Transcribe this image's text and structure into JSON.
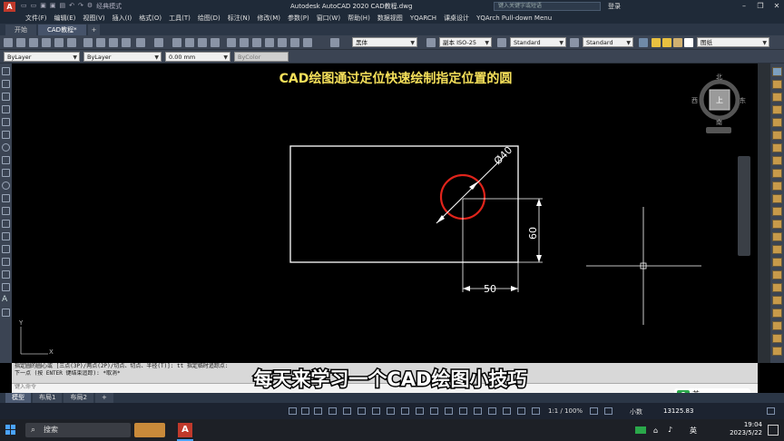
{
  "titlebar": {
    "workspace": "经典模式",
    "app_title": "Autodesk AutoCAD 2020   CAD教程.dwg",
    "search_placeholder": "键入关键字或短语",
    "login": "登录"
  },
  "menu": [
    "文件(F)",
    "编辑(E)",
    "视图(V)",
    "插入(I)",
    "格式(O)",
    "工具(T)",
    "绘图(D)",
    "标注(N)",
    "修改(M)",
    "参数(P)",
    "窗口(W)",
    "帮助(H)",
    "数据视图",
    "YQARCH",
    "课桌设计",
    "YQArch Pull-down Menu"
  ],
  "tabs": [
    "开始",
    "CAD教程*"
  ],
  "toolbar": {
    "text_style": "黑体",
    "dim_style": "副本 ISO-25",
    "table_style": "Standard",
    "multileader_style": "Standard",
    "layer_label": "图纸",
    "color": "ByLayer",
    "linetype": "ByLayer",
    "lineweight": "0.00 mm",
    "plotstyle": "ByColor"
  },
  "drawing": {
    "heading": "CAD绘图通过定位快速绘制指定位置的圆",
    "dim_diameter": "Ø40",
    "dim_vertical": "60",
    "dim_horizontal": "50",
    "ucs_y": "Y",
    "ucs_x": "X"
  },
  "viewcube": {
    "north": "北",
    "south": "南",
    "east": "东",
    "west": "西",
    "top": "上"
  },
  "command": {
    "history_1": "指定圆的圆心或 [三点(3P)/两点(2P)/切点、切点、半径(T)]: tt 指定临时追踪点:",
    "history_2": "下一点 (按 ENTER 键结束追踪): *取消*",
    "input_placeholder": "键入命令"
  },
  "subtitle": "每天来学习一个CAD绘图小技巧",
  "layout_tabs": [
    "模型",
    "布局1",
    "布局2"
  ],
  "status": {
    "coords": "13125.83",
    "scale": "1:1 / 100%",
    "units": "小数",
    "ime": "英",
    "ime_tray": "英"
  },
  "taskbar": {
    "search_label": "搜索",
    "time": "19:04",
    "date": "2023/5/22"
  },
  "colors": {
    "circle": "#e0241b",
    "heading": "#f5e05a",
    "geometry": "#ffffff"
  }
}
